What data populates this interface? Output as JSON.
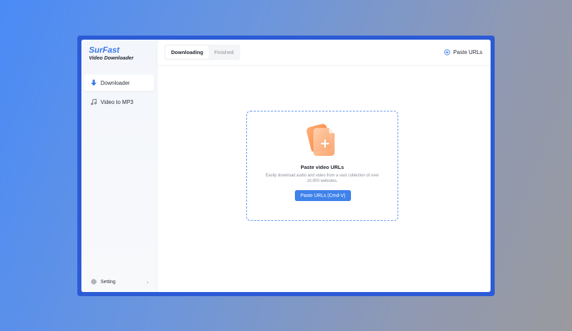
{
  "app": {
    "brand_name": "SurFast",
    "brand_sub": "Video Downloader"
  },
  "sidebar": {
    "items": [
      {
        "label": "Downloader",
        "icon": "download-arrow-icon",
        "active": true
      },
      {
        "label": "Video to MP3",
        "icon": "music-note-icon",
        "active": false
      }
    ],
    "setting_label": "Setting",
    "setting_icon": "gear-icon"
  },
  "header": {
    "tabs": [
      {
        "label": "Downloading",
        "active": true
      },
      {
        "label": "Finished",
        "active": false
      }
    ],
    "paste_label": "Paste URLs",
    "paste_icon": "plus-circle-icon"
  },
  "dropzone": {
    "title": "Paste video URLs",
    "description": "Easily download audio and video from a vast collection of over 10,000 websites.",
    "button_label": "Paste URLs (Cmd-V)",
    "illustration": "file-add-icon"
  },
  "colors": {
    "accent": "#3f82ea",
    "brand": "#3a78e8",
    "frame": "#2b5bd6",
    "illustration_orange": "#f98a3c"
  }
}
